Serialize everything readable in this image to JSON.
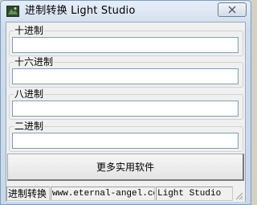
{
  "window": {
    "title": "进制转换  Light Studio",
    "icon": "app-icon",
    "close_icon": "close-icon"
  },
  "groups": [
    {
      "label": "十进制",
      "value": ""
    },
    {
      "label": "十六进制",
      "value": ""
    },
    {
      "label": "八进制",
      "value": ""
    },
    {
      "label": "二进制",
      "value": ""
    }
  ],
  "more_button": {
    "label": "更多实用软件"
  },
  "statusbar": {
    "pane1": "进制转换",
    "pane2": "www.eternal-angel.com",
    "pane3": "Light Studio"
  },
  "colors": {
    "title_gradient_top": "#e6eef8",
    "title_gradient_bottom": "#cad8ea",
    "client_bg": "#f0f0f0",
    "field_border": "#7f9db9"
  }
}
